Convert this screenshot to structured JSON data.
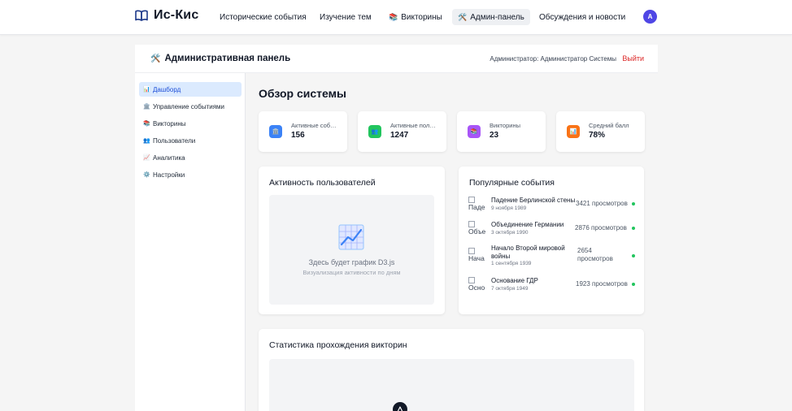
{
  "nav": {
    "logo": "Ис-Кис",
    "items": [
      {
        "label": "Исторические события",
        "emoji": ""
      },
      {
        "label": "Изучение тем",
        "emoji": ""
      },
      {
        "label": "Викторины",
        "emoji": "📚"
      },
      {
        "label": "Админ-панель",
        "emoji": "🛠️"
      },
      {
        "label": "Обсуждения и новости",
        "emoji": ""
      }
    ],
    "avatar": "A"
  },
  "admin_header": {
    "emoji": "🛠️",
    "title": "Административная панель",
    "user": "Администратор: Администратор Системы",
    "logout": "Выйти"
  },
  "sidebar": {
    "items": [
      {
        "label": "Дашборд",
        "emoji": "📊"
      },
      {
        "label": "Управление событиями",
        "emoji": "🏛️"
      },
      {
        "label": "Викторины",
        "emoji": "📚"
      },
      {
        "label": "Пользователи",
        "emoji": "👥"
      },
      {
        "label": "Аналитика",
        "emoji": "📈"
      },
      {
        "label": "Настройки",
        "emoji": "⚙️"
      }
    ]
  },
  "main": {
    "title": "Обзор системы",
    "stats": [
      {
        "label": "Активные события",
        "value": "156",
        "emoji": "🏛️",
        "color": "#3b82f6"
      },
      {
        "label": "Активные пользователи",
        "value": "1247",
        "emoji": "👥",
        "color": "#22c55e"
      },
      {
        "label": "Викторины",
        "value": "23",
        "emoji": "📚",
        "color": "#a855f7"
      },
      {
        "label": "Средний балл",
        "value": "78%",
        "emoji": "📊",
        "color": "#f97316"
      }
    ],
    "activity": {
      "title": "Активность пользователей",
      "placeholder_title": "Здесь будет график D3.js",
      "placeholder_sub": "Визуализация активности по дням"
    },
    "popular": {
      "title": "Популярные события",
      "events": [
        {
          "alt": "Паде",
          "name": "Падение Берлинской стены",
          "date": "9 ноября 1989",
          "views": "3421 просмотров"
        },
        {
          "alt": "Объе",
          "name": "Объединение Германии",
          "date": "3 октября 1990",
          "views": "2876 просмотров"
        },
        {
          "alt": "Нача",
          "name": "Начало Второй мировой войны",
          "date": "1 сентября 1939",
          "views": "2654 просмотров"
        },
        {
          "alt": "Осно",
          "name": "Основание ГДР",
          "date": "7 октября 1949",
          "views": "1923 просмотров"
        }
      ]
    },
    "quiz_stats": {
      "title": "Статистика прохождения викторин"
    }
  },
  "colors": {
    "accent": "#4f46e5",
    "logout": "#dc2626",
    "active_bg": "#dbeafe",
    "status_dot": "#22c55e"
  }
}
